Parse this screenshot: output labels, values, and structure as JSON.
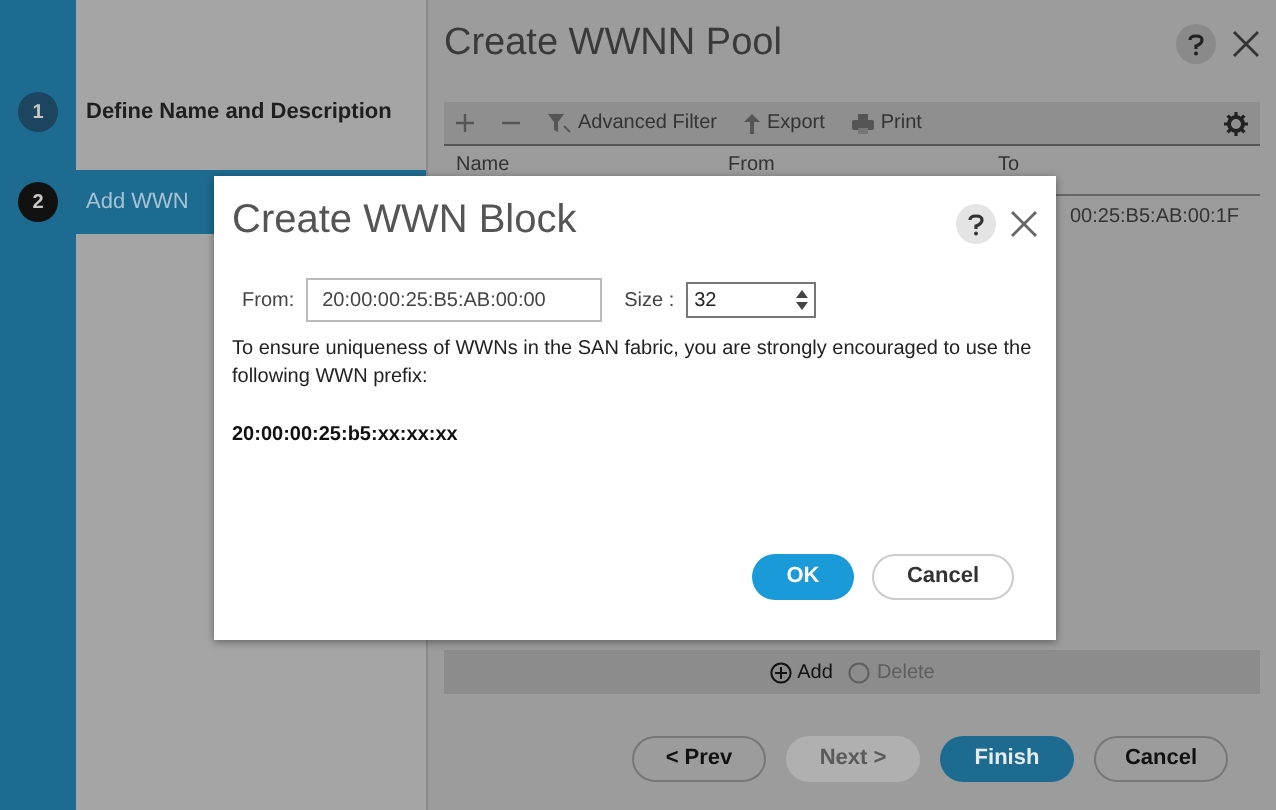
{
  "wizard": {
    "steps": [
      {
        "number": "1",
        "label": "Define Name and Description",
        "selected": false
      },
      {
        "number": "2",
        "label": "Add WWN",
        "selected": true
      }
    ]
  },
  "main": {
    "title": "Create WWNN Pool",
    "toolbar": [
      {
        "kind": "filter",
        "label": "Advanced Filter"
      },
      {
        "kind": "export",
        "label": "Export"
      },
      {
        "kind": "print",
        "label": "Print"
      }
    ],
    "table": {
      "columns": [
        "Name",
        "From",
        "To"
      ],
      "rows": [
        {
          "to": "00:25:B5:AB:00:1F"
        }
      ]
    },
    "table_actions": [
      {
        "label": "Add",
        "disabled": false
      },
      {
        "label": "Delete",
        "disabled": true
      }
    ],
    "nav_buttons": [
      {
        "label": "< Prev",
        "primary": false,
        "disabled": false
      },
      {
        "label": "Next >",
        "primary": false,
        "disabled": true
      },
      {
        "label": "Finish",
        "primary": true,
        "disabled": false
      },
      {
        "label": "Cancel",
        "primary": false,
        "disabled": false
      }
    ]
  },
  "dialog": {
    "title": "Create WWN Block",
    "from_label": "From:",
    "from_value": "20:00:00:25:B5:AB:00:00",
    "size_label": "Size :",
    "size_value": "32",
    "message": "To ensure uniqueness of WWNs in the SAN fabric, you are strongly encouraged to use the following WWN prefix:",
    "prefix": "20:00:00:25:b5:xx:xx:xx",
    "buttons": [
      {
        "label": "OK",
        "primary": true
      },
      {
        "label": "Cancel",
        "primary": false
      }
    ]
  }
}
